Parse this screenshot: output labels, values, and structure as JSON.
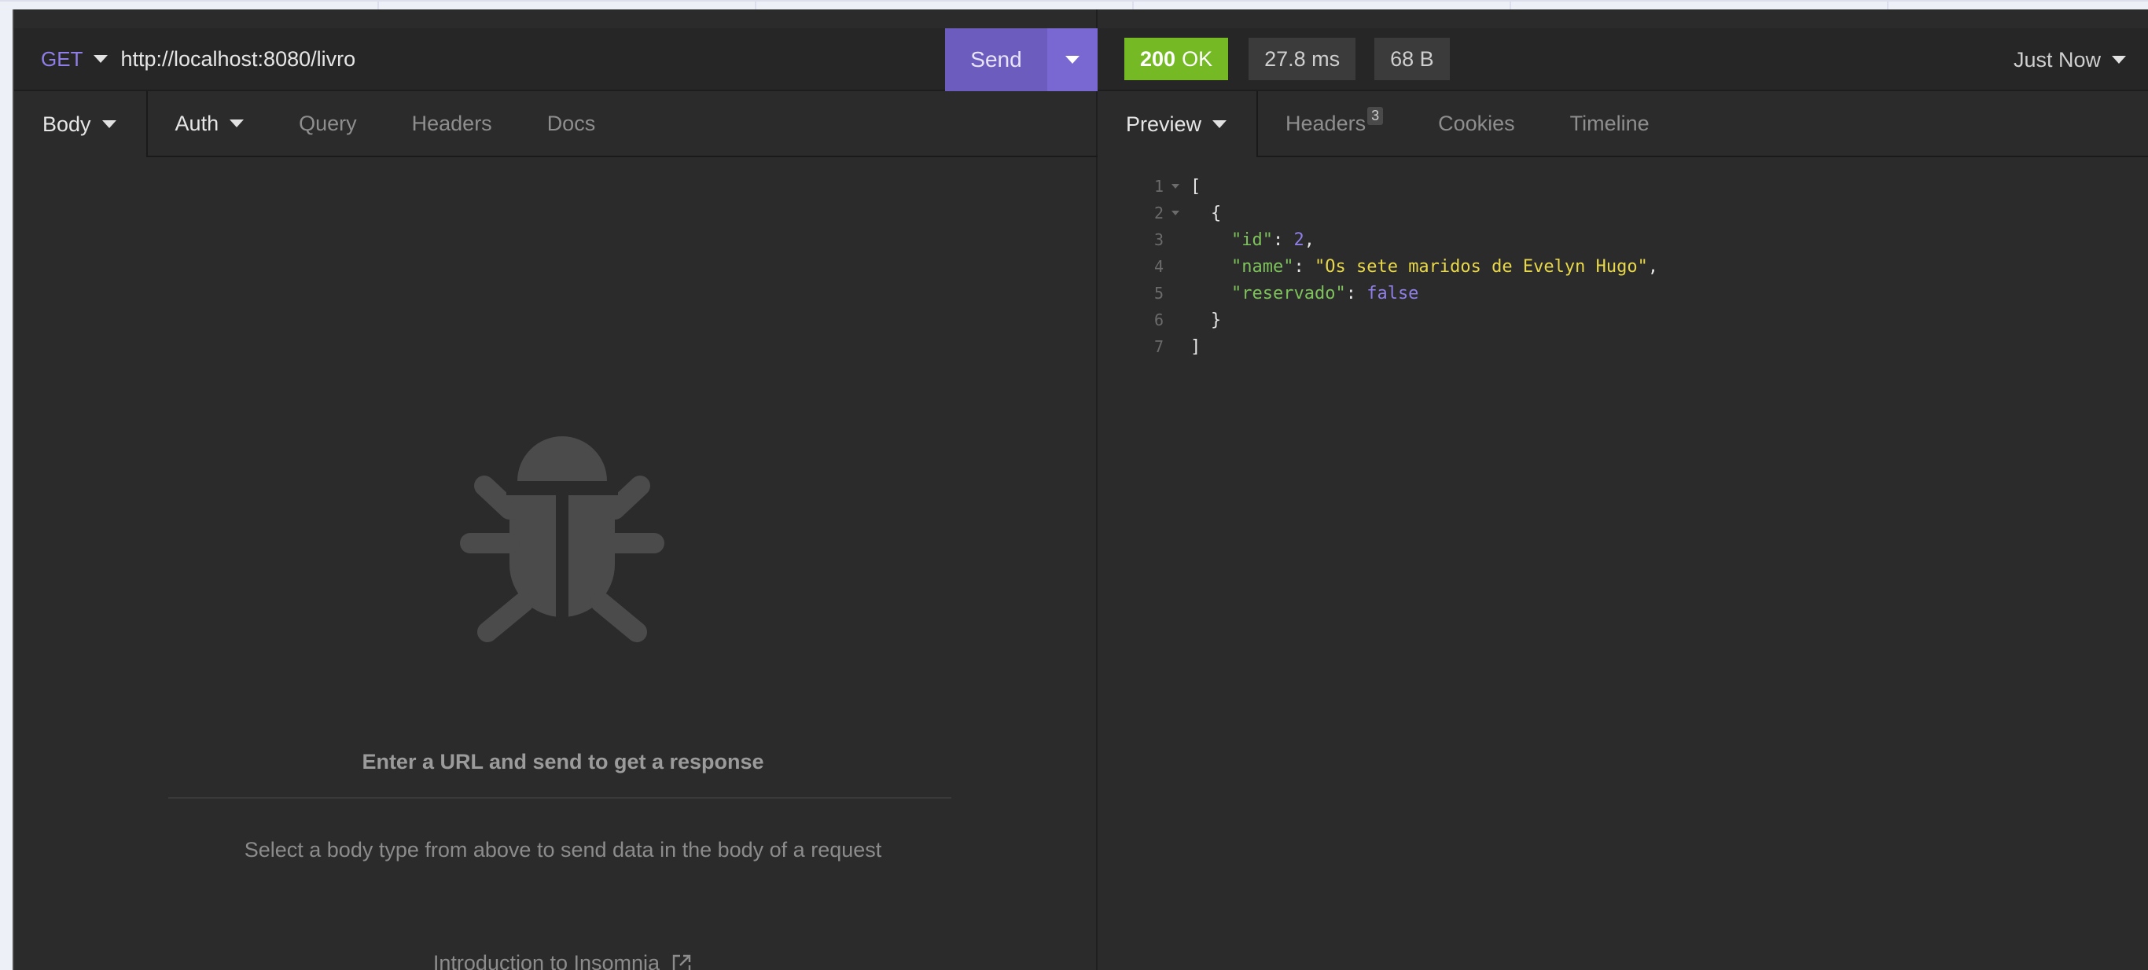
{
  "request": {
    "method": "GET",
    "url": "http://localhost:8080/livro",
    "send_label": "Send",
    "tabs": [
      {
        "label": "Body"
      },
      {
        "label": "Auth"
      },
      {
        "label": "Query"
      },
      {
        "label": "Headers"
      },
      {
        "label": "Docs"
      }
    ],
    "empty_state": {
      "title": "Enter a URL and send to get a response",
      "subtitle": "Select a body type from above to send data in the body of a request",
      "link": "Introduction to Insomnia"
    }
  },
  "response": {
    "status_code": "200",
    "status_text": "OK",
    "time": "27.8 ms",
    "size": "68 B",
    "history": "Just Now",
    "tabs": [
      {
        "label": "Preview"
      },
      {
        "label": "Headers",
        "count": "3"
      },
      {
        "label": "Cookies"
      },
      {
        "label": "Timeline"
      }
    ],
    "lines": [
      {
        "no": "1",
        "text": "["
      },
      {
        "no": "2",
        "text": "{"
      },
      {
        "no": "3",
        "key": "\"id\"",
        "value": "2",
        "trail": ","
      },
      {
        "no": "4",
        "key": "\"name\"",
        "value": "\"Os sete maridos de Evelyn Hugo\"",
        "trail": ","
      },
      {
        "no": "5",
        "key": "\"reservado\"",
        "value": "false",
        "trail": ""
      },
      {
        "no": "6",
        "text": "}"
      },
      {
        "no": "7",
        "text": "]"
      }
    ]
  },
  "colors": {
    "accent": "#6c5cbe",
    "status_ok": "#75ba24",
    "json_key": "#7dc25b",
    "json_string": "#e8d84a",
    "json_literal": "#8f7ee7"
  },
  "icons": {
    "method_dropdown": "chevron-down-icon",
    "send_dropdown": "chevron-down-icon",
    "empty_state": "bug-icon",
    "external_link": "external-link-icon"
  }
}
